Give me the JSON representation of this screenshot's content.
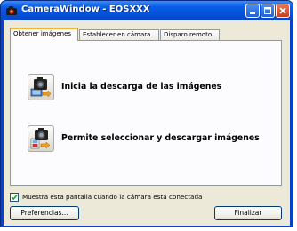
{
  "window": {
    "title": "CameraWindow - EOSXXX",
    "icon": "camera-app-icon",
    "controls": [
      "minimize-icon",
      "maximize-icon",
      "close-icon"
    ]
  },
  "tabs": [
    {
      "label": "Obtener imágenes",
      "active": true
    },
    {
      "label": "Establecer en cámara",
      "active": false
    },
    {
      "label": "Disparo remoto",
      "active": false
    }
  ],
  "actions": [
    {
      "label": "Inicia la descarga de las imágenes",
      "icon": "camera-to-computer-icon"
    },
    {
      "label": "Permite seleccionar y descargar imágenes",
      "icon": "camera-select-images-icon"
    }
  ],
  "startup_checkbox": {
    "label": "Muestra esta pantalla cuando la cámara está conectada",
    "checked": true
  },
  "buttons": {
    "preferences": "Preferencias...",
    "finish": "Finalizar"
  },
  "colors": {
    "titlebar": "#0b5de8",
    "dialog_bg": "#ece9d8",
    "active_tab_accent": "#f8b332",
    "close_button": "#c8401c"
  }
}
